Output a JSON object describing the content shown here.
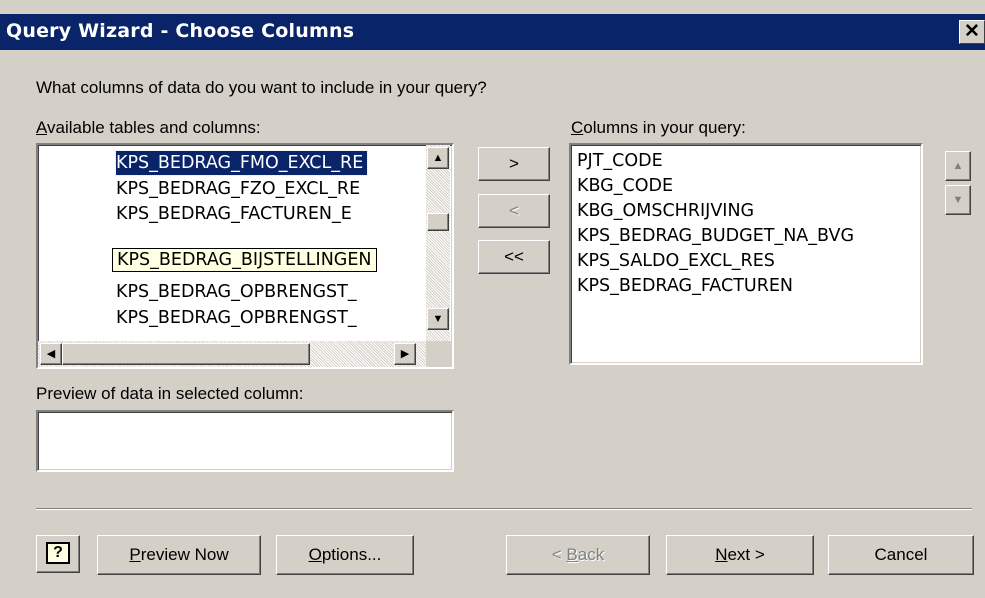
{
  "window": {
    "title": "Query Wizard - Choose Columns",
    "close_glyph": "✕"
  },
  "prompt": "What columns of data do you want to include in your query?",
  "available": {
    "label_first": "A",
    "label_rest": "vailable tables and columns:",
    "items": [
      "KPS_BEDRAG_FMO_EXCL_RE",
      "KPS_BEDRAG_FZO_EXCL_RE",
      "KPS_BEDRAG_FACTUREN_E",
      "KPS_BEDRAG_BIJSTELLINGEN",
      "KPS_BEDRAG_OPBRENGST_",
      "KPS_BEDRAG_OPBRENGST_"
    ]
  },
  "query": {
    "label_first": "C",
    "label_rest": "olumns in your query:",
    "items": [
      "PJT_CODE",
      "KBG_CODE",
      "KBG_OMSCHRIJVING",
      "KPS_BEDRAG_BUDGET_NA_BVG",
      "KPS_SALDO_EXCL_RES",
      "KPS_BEDRAG_FACTUREN"
    ]
  },
  "transfer": {
    "add": ">",
    "remove": "<",
    "remove_all": "<<"
  },
  "preview": {
    "label": "Preview of data in selected column:",
    "value": ""
  },
  "footer": {
    "help": "?",
    "preview_first": "P",
    "preview_rest": "review Now",
    "options_first": "O",
    "options_rest": "ptions...",
    "back_pre": "< ",
    "back_first": "B",
    "back_rest": "ack",
    "next_first": "N",
    "next_rest": "ext >",
    "cancel": "Cancel"
  },
  "icons": {
    "up": "▲",
    "down": "▼",
    "left": "◀",
    "right": "▶"
  }
}
